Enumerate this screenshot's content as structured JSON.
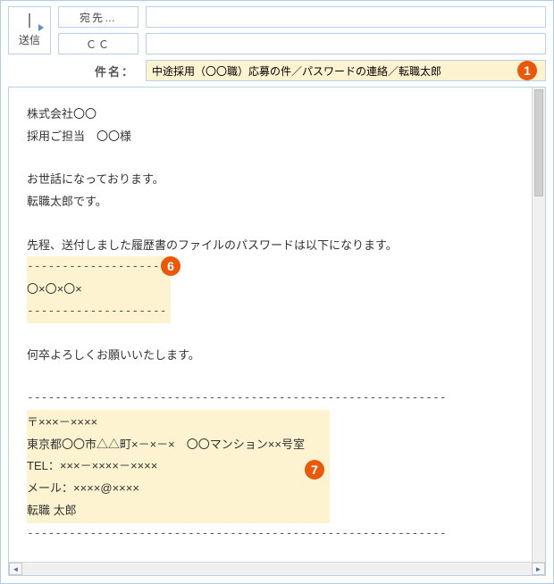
{
  "colors": {
    "accent": "#e8590c",
    "border": "#b8d0e8",
    "highlight": "#fdf3d0"
  },
  "header": {
    "send_label": "送信",
    "to_button": "宛先…",
    "cc_button": "ＣＣ",
    "subject_label": "件名：",
    "to_value": "",
    "cc_value": "",
    "subject_value": "中途採用（〇〇職）応募の件／パスワードの連絡／転職太郎"
  },
  "badges": {
    "b1": "1",
    "b6": "6",
    "b7": "7"
  },
  "body": {
    "line1": "株式会社〇〇",
    "line2": "採用ご担当　〇〇様",
    "line3": "お世話になっております。",
    "line4": "転職太郎です。",
    "line5": "先程、送付しました履歴書のファイルのパスワードは以下になります。",
    "dash_short": "--------------------",
    "password": "〇×〇×〇×",
    "line6": "何卒よろしくお願いいたします。",
    "dash_long": "------------------------------------------------------------",
    "sig1": "〒×××－××××",
    "sig2": "東京都〇〇市△△町×－×－×　〇〇マンション××号室",
    "sig3": "TEL：×××－××××－××××",
    "sig4": "メール：××××@××××",
    "sig5": "転職  太郎"
  }
}
